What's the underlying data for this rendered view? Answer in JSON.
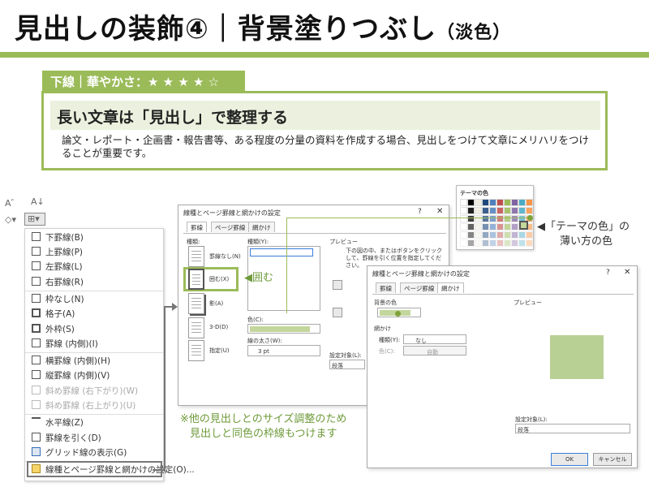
{
  "header": {
    "title": "見出しの装飾④｜背景塗りつぶし",
    "subtitle": "（淡色）"
  },
  "tag": {
    "label": "下線｜華やかさ：★ ★ ★ ★ ☆"
  },
  "panel": {
    "heading": "長い文章は「見出し」で整理する",
    "body": "論文・レポート・企画書・報告書等、ある程度の分量の資料を作成する場合、見出しをつけて文章にメリハリをつけることが重要です。"
  },
  "ribbon": {
    "items": [
      "A゛",
      "A↓"
    ]
  },
  "menu": {
    "items": [
      "下罫線(B)",
      "上罫線(P)",
      "左罫線(L)",
      "右罫線(R)",
      "枠なし(N)",
      "格子(A)",
      "外枠(S)",
      "罫線 (内側)(I)",
      "横罫線 (内側)(H)",
      "縦罫線 (内側)(V)",
      "斜め罫線 (右下がり)(W)",
      "斜め罫線 (右上がり)(U)",
      "水平線(Z)",
      "罫線を引く(D)",
      "グリッド線の表示(G)",
      "線種とページ罫線と網かけの設定(O)..."
    ]
  },
  "dialog1": {
    "title": "線種とページ罫線と網かけの設定",
    "tabs": [
      "罫線",
      "ページ罫線",
      "網かけ"
    ],
    "kind_label": "種類:",
    "kinds": [
      "罫線なし(N)",
      "囲む(X)",
      "影(A)",
      "3-D(D)",
      "指定(U)"
    ],
    "style_label": "種類(Y):",
    "color_label": "色(C):",
    "width_label": "線の太さ(W):",
    "width_value": "3 pt",
    "preview_label": "プレビュー",
    "preview_text": "下の図の中、またはボタンをクリックして、罫線を引く位置を指定してください。",
    "apply_label": "設定対象(L):",
    "apply_value": "段落"
  },
  "dialog2": {
    "title": "線種とページ罫線と網かけの設定",
    "tabs": [
      "罫線",
      "ページ罫線",
      "網かけ"
    ],
    "fill_label": "背景の色",
    "pattern_label": "網かけ",
    "pattern_kind_label": "種類(Y):",
    "pattern_kind_value": "なし",
    "pattern_color_label": "色(C):",
    "pattern_color_value": "自動",
    "preview_label": "プレビュー",
    "apply_label": "設定対象(L):",
    "apply_value": "段落",
    "ok": "OK",
    "cancel": "キャンセル"
  },
  "palette": {
    "title": "テーマの色"
  },
  "callouts": {
    "kakomu": "◀囲む",
    "theme_line1": "◀「テーマの色」の",
    "theme_line2": "薄い方の色"
  },
  "note": {
    "line1": "※他の見出しとのサイズ調整のため",
    "line2": "見出しと同色の枠線もつけます"
  },
  "colors": {
    "accent": "#9bbb59",
    "light_green": "#c3d69b",
    "panel_bg": "#ebf1de"
  }
}
